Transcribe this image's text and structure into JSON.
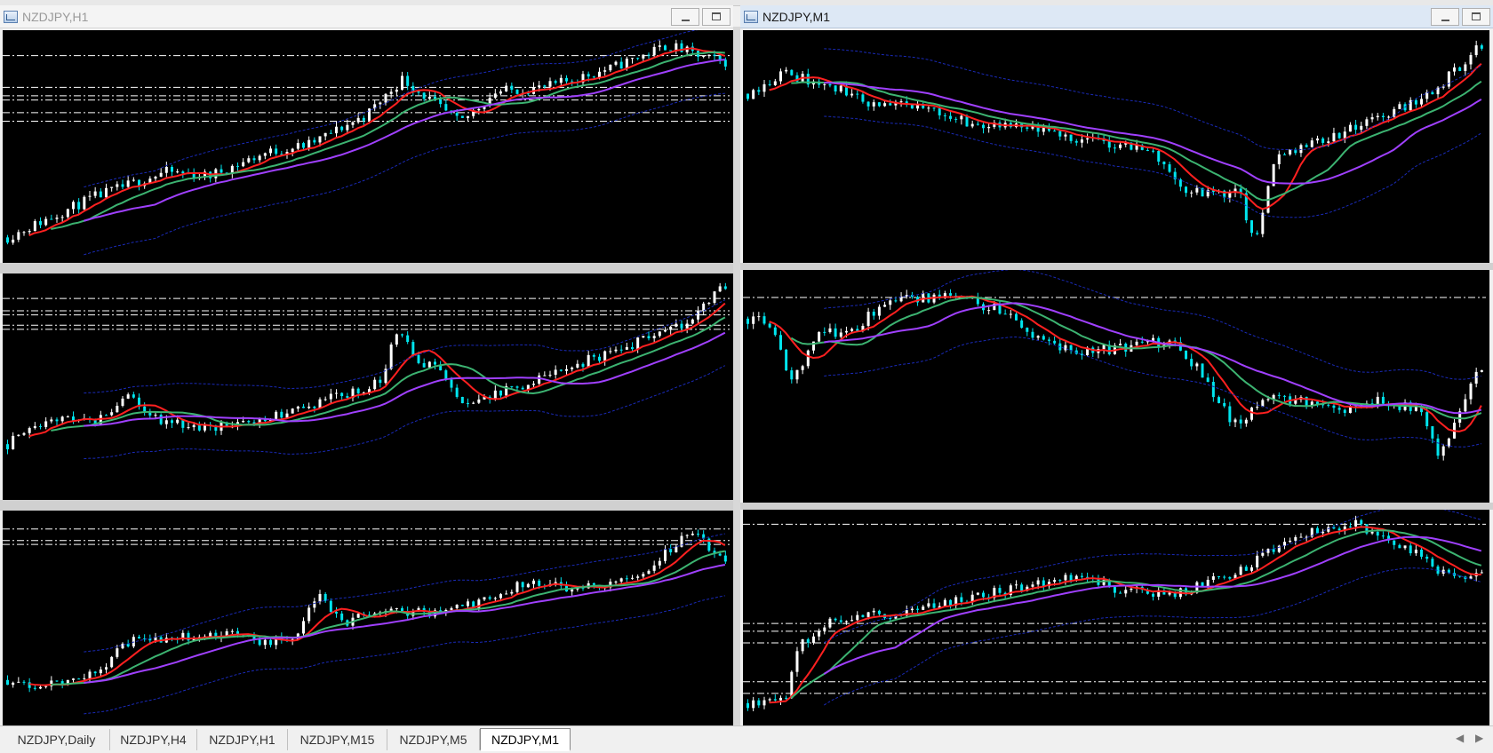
{
  "windows": {
    "left_title": "NZDJPY,H1",
    "right_title": "NZDJPY,M1"
  },
  "tabs": [
    {
      "label": "NZDJPY,Daily",
      "active": false
    },
    {
      "label": "NZDJPY,H4",
      "active": false
    },
    {
      "label": "NZDJPY,H1",
      "active": false
    },
    {
      "label": "NZDJPY,M15",
      "active": false
    },
    {
      "label": "NZDJPY,M5",
      "active": false
    },
    {
      "label": "NZDJPY,M1",
      "active": true
    }
  ],
  "colors": {
    "background": "#000000",
    "bull_candle": "#ffffff",
    "bear_candle": "#00e5ee",
    "ma_fast": "#ff2020",
    "ma_mid": "#3cb371",
    "ma_slow": "#a040ff",
    "envelope": "#1a2ab8",
    "level_lines": "#ffffff"
  },
  "icons": {
    "window_icon": "chart-window-icon",
    "minimize": "minimize-icon",
    "maximize": "maximize-icon",
    "scroll_left": "scroll-left-icon",
    "scroll_right": "scroll-right-icon"
  },
  "chart_data": [
    {
      "type": "line",
      "seed": 11,
      "path": [
        [
          0,
          0.07
        ],
        [
          0.12,
          0.26
        ],
        [
          0.22,
          0.38
        ],
        [
          0.28,
          0.36
        ],
        [
          0.36,
          0.47
        ],
        [
          0.42,
          0.51
        ],
        [
          0.5,
          0.65
        ],
        [
          0.55,
          0.82
        ],
        [
          0.63,
          0.61
        ],
        [
          0.68,
          0.76
        ],
        [
          0.75,
          0.78
        ],
        [
          0.84,
          0.87
        ],
        [
          0.92,
          0.98
        ],
        [
          0.97,
          0.92
        ],
        [
          1,
          0.9
        ]
      ],
      "levels": [
        0.93,
        0.78,
        0.74,
        0.72,
        0.66,
        0.62
      ],
      "series": [
        {
          "kind": "ma",
          "period": 8,
          "color": "#ff2020"
        },
        {
          "kind": "ma",
          "period": 16,
          "color": "#3cb371"
        },
        {
          "kind": "ma",
          "period": 28,
          "color": "#a040ff"
        },
        {
          "kind": "envelope",
          "period": 28,
          "offset": 0.16,
          "color": "#1a2ab8"
        }
      ]
    },
    {
      "type": "line",
      "seed": 23,
      "path": [
        [
          0,
          0.75
        ],
        [
          0.05,
          0.85
        ],
        [
          0.13,
          0.76
        ],
        [
          0.17,
          0.7
        ],
        [
          0.25,
          0.68
        ],
        [
          0.31,
          0.6
        ],
        [
          0.38,
          0.58
        ],
        [
          0.45,
          0.54
        ],
        [
          0.55,
          0.48
        ],
        [
          0.6,
          0.28
        ],
        [
          0.67,
          0.28
        ],
        [
          0.69,
          0.03
        ],
        [
          0.72,
          0.45
        ],
        [
          0.75,
          0.5
        ],
        [
          0.8,
          0.55
        ],
        [
          0.87,
          0.65
        ],
        [
          0.93,
          0.75
        ],
        [
          1,
          0.98
        ]
      ],
      "levels": [],
      "series": [
        {
          "kind": "ma",
          "period": 8,
          "color": "#ff2020"
        },
        {
          "kind": "ma",
          "period": 16,
          "color": "#3cb371"
        },
        {
          "kind": "ma",
          "period": 28,
          "color": "#a040ff"
        },
        {
          "kind": "envelope",
          "period": 28,
          "offset": 0.16,
          "color": "#1a2ab8"
        }
      ]
    },
    {
      "type": "line",
      "seed": 37,
      "path": [
        [
          0,
          0.22
        ],
        [
          0.06,
          0.35
        ],
        [
          0.12,
          0.33
        ],
        [
          0.17,
          0.45
        ],
        [
          0.22,
          0.32
        ],
        [
          0.28,
          0.3
        ],
        [
          0.35,
          0.33
        ],
        [
          0.42,
          0.41
        ],
        [
          0.47,
          0.46
        ],
        [
          0.52,
          0.52
        ],
        [
          0.54,
          0.79
        ],
        [
          0.58,
          0.6
        ],
        [
          0.6,
          0.6
        ],
        [
          0.63,
          0.4
        ],
        [
          0.67,
          0.45
        ],
        [
          0.72,
          0.51
        ],
        [
          0.8,
          0.62
        ],
        [
          0.88,
          0.72
        ],
        [
          0.94,
          0.8
        ],
        [
          1,
          0.99
        ]
      ],
      "levels": [
        0.93,
        0.87,
        0.85,
        0.8,
        0.78
      ],
      "series": [
        {
          "kind": "ma",
          "period": 8,
          "color": "#ff2020"
        },
        {
          "kind": "ma",
          "period": 16,
          "color": "#3cb371"
        },
        {
          "kind": "ma",
          "period": 28,
          "color": "#a040ff"
        },
        {
          "kind": "envelope",
          "period": 28,
          "offset": 0.16,
          "color": "#1a2ab8"
        }
      ]
    },
    {
      "type": "line",
      "seed": 41,
      "path": [
        [
          0,
          0.82
        ],
        [
          0.03,
          0.8
        ],
        [
          0.06,
          0.52
        ],
        [
          0.1,
          0.75
        ],
        [
          0.14,
          0.75
        ],
        [
          0.19,
          0.92
        ],
        [
          0.28,
          0.92
        ],
        [
          0.36,
          0.85
        ],
        [
          0.4,
          0.7
        ],
        [
          0.45,
          0.66
        ],
        [
          0.53,
          0.69
        ],
        [
          0.58,
          0.72
        ],
        [
          0.62,
          0.55
        ],
        [
          0.66,
          0.32
        ],
        [
          0.72,
          0.46
        ],
        [
          0.8,
          0.38
        ],
        [
          0.86,
          0.44
        ],
        [
          0.92,
          0.37
        ],
        [
          0.94,
          0.15
        ],
        [
          0.97,
          0.4
        ],
        [
          1,
          0.6
        ]
      ],
      "levels": [
        0.92
      ],
      "series": [
        {
          "kind": "ma",
          "period": 8,
          "color": "#ff2020"
        },
        {
          "kind": "ma",
          "period": 16,
          "color": "#3cb371"
        },
        {
          "kind": "ma",
          "period": 28,
          "color": "#a040ff"
        },
        {
          "kind": "envelope",
          "period": 28,
          "offset": 0.16,
          "color": "#1a2ab8"
        }
      ]
    },
    {
      "type": "line",
      "seed": 53,
      "path": [
        [
          0,
          0.18
        ],
        [
          0.05,
          0.15
        ],
        [
          0.12,
          0.21
        ],
        [
          0.17,
          0.38
        ],
        [
          0.22,
          0.4
        ],
        [
          0.3,
          0.42
        ],
        [
          0.35,
          0.38
        ],
        [
          0.4,
          0.38
        ],
        [
          0.43,
          0.62
        ],
        [
          0.47,
          0.48
        ],
        [
          0.52,
          0.55
        ],
        [
          0.6,
          0.52
        ],
        [
          0.66,
          0.58
        ],
        [
          0.72,
          0.68
        ],
        [
          0.78,
          0.66
        ],
        [
          0.85,
          0.68
        ],
        [
          0.9,
          0.78
        ],
        [
          0.95,
          0.95
        ],
        [
          1,
          0.8
        ]
      ],
      "levels": [
        0.96,
        0.9,
        0.88
      ],
      "series": [
        {
          "kind": "ma",
          "period": 8,
          "color": "#ff2020"
        },
        {
          "kind": "ma",
          "period": 16,
          "color": "#3cb371"
        },
        {
          "kind": "ma",
          "period": 28,
          "color": "#a040ff"
        },
        {
          "kind": "envelope",
          "period": 28,
          "offset": 0.16,
          "color": "#1a2ab8"
        }
      ]
    },
    {
      "type": "line",
      "seed": 67,
      "path": [
        [
          0,
          0.06
        ],
        [
          0.05,
          0.08
        ],
        [
          0.07,
          0.35
        ],
        [
          0.12,
          0.5
        ],
        [
          0.2,
          0.52
        ],
        [
          0.3,
          0.6
        ],
        [
          0.4,
          0.68
        ],
        [
          0.45,
          0.72
        ],
        [
          0.5,
          0.65
        ],
        [
          0.58,
          0.62
        ],
        [
          0.66,
          0.72
        ],
        [
          0.73,
          0.88
        ],
        [
          0.78,
          0.96
        ],
        [
          0.83,
          0.98
        ],
        [
          0.9,
          0.86
        ],
        [
          0.94,
          0.75
        ],
        [
          0.98,
          0.7
        ],
        [
          1,
          0.75
        ]
      ],
      "levels": [
        0.98,
        0.47,
        0.43,
        0.37,
        0.17,
        0.11
      ],
      "series": [
        {
          "kind": "ma",
          "period": 8,
          "color": "#ff2020"
        },
        {
          "kind": "ma",
          "period": 16,
          "color": "#3cb371"
        },
        {
          "kind": "ma",
          "period": 28,
          "color": "#a040ff"
        },
        {
          "kind": "envelope",
          "period": 28,
          "offset": 0.16,
          "color": "#1a2ab8"
        }
      ]
    }
  ]
}
